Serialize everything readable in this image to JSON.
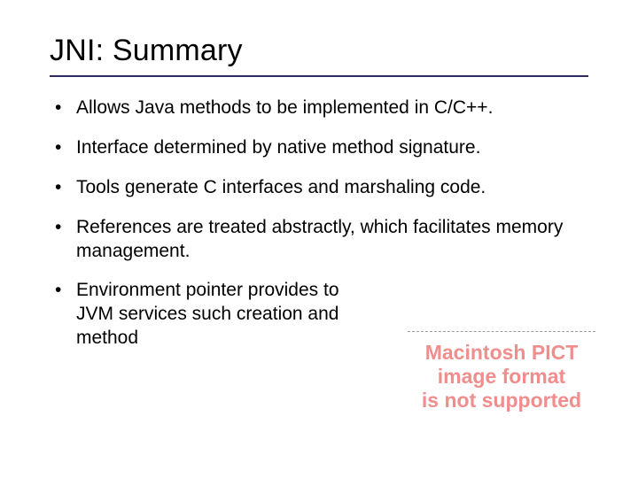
{
  "title": "JNI: Summary",
  "bullets": [
    "Allows Java methods to be implemented in C/C++.",
    "Interface determined by native method signature.",
    "Tools generate C interfaces and marshaling code.",
    "References are treated abstractly, which facilitates memory management.",
    "Environment pointer provides to JVM services such creation and method"
  ],
  "pict": {
    "line1": "Macintosh PICT",
    "line2": "image format",
    "line3": "is not supported"
  }
}
